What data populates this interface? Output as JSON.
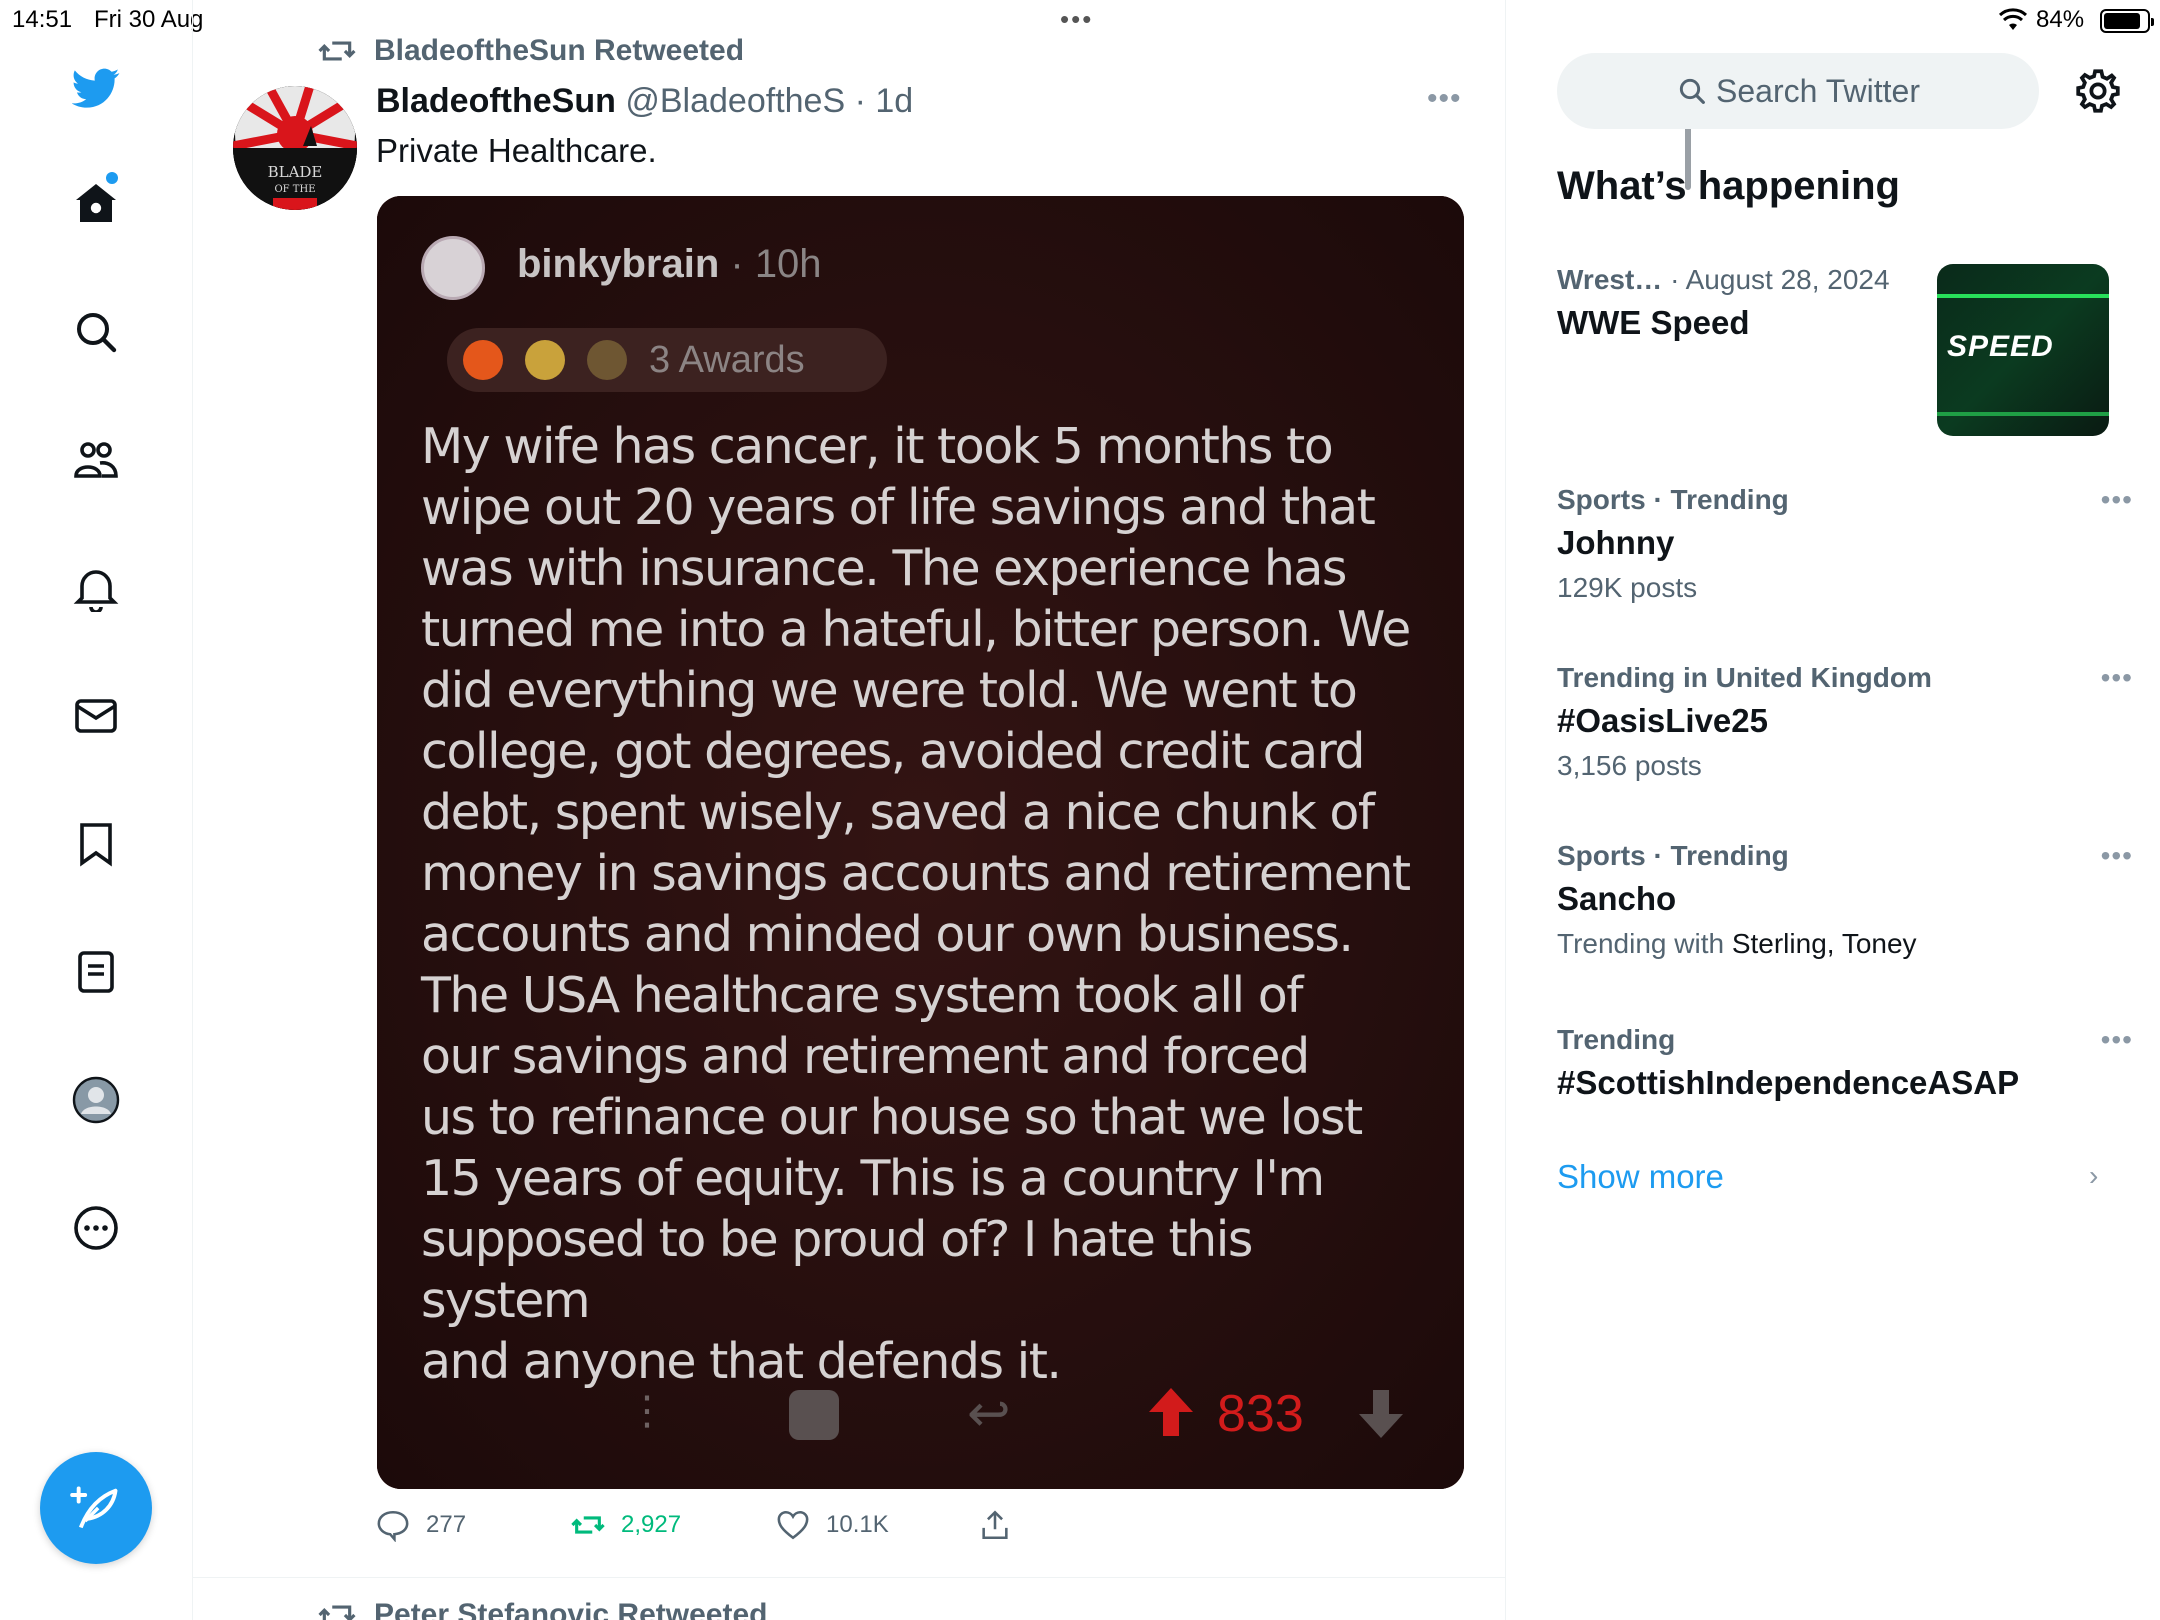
{
  "status": {
    "time": "14:51",
    "date": "Fri 30 Aug",
    "battery": "84%",
    "battery_level": 0.84
  },
  "nav": {
    "items": [
      "home",
      "explore",
      "communities",
      "notifications",
      "messages",
      "bookmarks",
      "lists",
      "profile",
      "more"
    ]
  },
  "tweet": {
    "retweeted_by": "BladeoftheSun Retweeted",
    "author_name": "BladeoftheSun",
    "handle_time": "@BladeoftheS · 1d",
    "text": "Private Healthcare.",
    "avatar_lines": [
      "BLADE",
      "OF THE"
    ],
    "media": {
      "username": "binkybrain",
      "time": " · 10h",
      "awards": "3 Awards",
      "body_lines": [
        "My wife has cancer, it took 5 months to",
        "wipe out 20 years of life savings and that",
        "was with insurance. The experience has",
        "turned me into a hateful, bitter person. We",
        "did everything we were told. We went to",
        "college, got degrees, avoided credit card",
        "debt, spent wisely, saved a nice chunk of",
        "money in savings accounts and retirement",
        "accounts and minded our own business.",
        "The USA healthcare system took all of",
        "our savings and retirement and forced",
        "us to refinance our house so that we lost",
        "15 years of equity. This is a country I'm",
        "supposed to be proud of? I hate this system",
        "and anyone that defends it."
      ],
      "score": "833"
    },
    "replies": "277",
    "retweets": "2,927",
    "likes": "10.1K"
  },
  "next_tweet": {
    "retweeted_by": "Peter Stefanovic Retweeted"
  },
  "right": {
    "search_placeholder": "Search Twitter",
    "section_title": "What’s happening",
    "trends": [
      {
        "category": "Wrest…",
        "extra": " · August 28, 2024",
        "topic": "WWE Speed",
        "count": "",
        "thumb_text": "SPEED"
      },
      {
        "category": "Sports · Trending",
        "extra": "",
        "topic": "Johnny",
        "count": "129K posts"
      },
      {
        "category": "Trending in United Kingdom",
        "extra": "",
        "topic": "#OasisLive25",
        "count": "3,156 posts"
      },
      {
        "category": "Sports · Trending",
        "extra": "",
        "topic": "Sancho",
        "count_prefix": "Trending with ",
        "count_names": "Sterling, Toney"
      },
      {
        "category": "Trending",
        "extra": "",
        "topic": "#ScottishIndependenceASAP",
        "count": ""
      }
    ],
    "show_more": "Show more"
  },
  "colors": {
    "accent": "#1d9bf0",
    "retweet_green": "#00ba7c",
    "upvote_red": "#d21b1b"
  }
}
